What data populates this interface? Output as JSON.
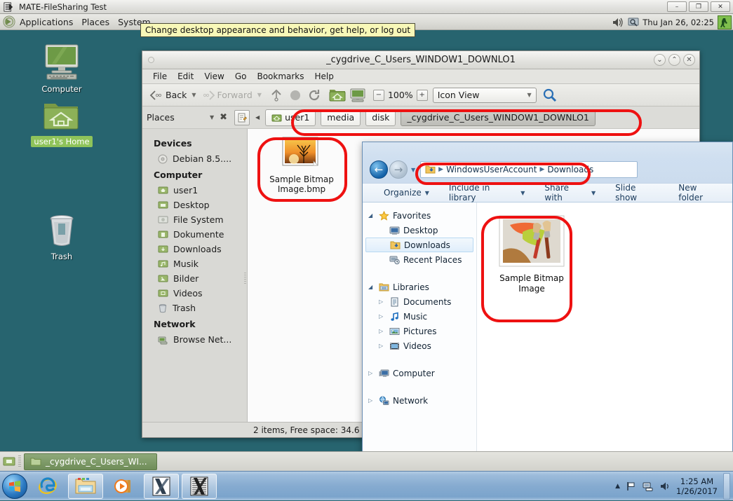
{
  "desktop": {
    "background_color": "#27646f",
    "icons": [
      {
        "label": "Computer",
        "icon": "computer-icon",
        "selected": false
      },
      {
        "label": "user1's Home",
        "icon": "home-folder-icon",
        "selected": true
      },
      {
        "label": "Trash",
        "icon": "trash-icon",
        "selected": false
      }
    ]
  },
  "mate_titlebar": {
    "title": "MATE-FileSharing Test",
    "icon": "window-menu-icon",
    "buttons": [
      {
        "name": "minimize",
        "glyph": "–"
      },
      {
        "name": "restore",
        "glyph": "❐"
      },
      {
        "name": "close",
        "glyph": "✕"
      }
    ]
  },
  "mate_panel": {
    "menus": [
      "Applications",
      "Places",
      "System"
    ],
    "clock": "Thu Jan 26, 02:25",
    "tray_icons": [
      "volume-icon",
      "screensaver-icon"
    ],
    "logout_icon": "logout-icon"
  },
  "tooltip": {
    "text": "Change desktop appearance and behavior, get help, or log out"
  },
  "caja": {
    "title": "_cygdrive_C_Users_WINDOW1_DOWNLO1",
    "window_buttons": [
      {
        "name": "minimize-icon",
        "glyph": "⌄"
      },
      {
        "name": "maximize-icon",
        "glyph": "⌃"
      },
      {
        "name": "close-icon",
        "glyph": "✕"
      }
    ],
    "menubar": [
      "File",
      "Edit",
      "View",
      "Go",
      "Bookmarks",
      "Help"
    ],
    "toolbar": {
      "back_label": "Back",
      "forward_label": "Forward",
      "up_icon": "up-arrow-icon",
      "stop_icon": "stop-icon",
      "reload_icon": "reload-icon",
      "home_icon": "home-icon",
      "computer_icon": "computer-icon",
      "zoom_out_glyph": "−",
      "zoom_value": "100%",
      "zoom_in_glyph": "+",
      "view_mode": "Icon View",
      "search_icon": "search-icon"
    },
    "location_bar": {
      "places_label": "Places",
      "places_dropdown_icon": "chevron-down-icon",
      "places_close_icon": "close-icon",
      "edit_location_icon": "edit-location-icon",
      "scroll_left_icon": "chevron-left-icon",
      "breadcrumbs": [
        {
          "label": "user1",
          "icon": "home-icon",
          "active": false
        },
        {
          "label": "media",
          "icon": "",
          "active": false
        },
        {
          "label": "disk",
          "icon": "",
          "active": false
        },
        {
          "label": "_cygdrive_C_Users_WINDOW1_DOWNLO1",
          "icon": "",
          "active": true
        }
      ]
    },
    "sidebar": {
      "groups": [
        {
          "heading": "Devices",
          "items": [
            {
              "label": "Debian 8.5....",
              "icon": "disc-icon"
            }
          ]
        },
        {
          "heading": "Computer",
          "items": [
            {
              "label": "user1",
              "icon": "home-folder-icon"
            },
            {
              "label": "Desktop",
              "icon": "desktop-folder-icon"
            },
            {
              "label": "File System",
              "icon": "filesystem-icon"
            },
            {
              "label": "Dokumente",
              "icon": "documents-folder-icon"
            },
            {
              "label": "Downloads",
              "icon": "downloads-folder-icon"
            },
            {
              "label": "Musik",
              "icon": "music-folder-icon"
            },
            {
              "label": "Bilder",
              "icon": "pictures-folder-icon"
            },
            {
              "label": "Videos",
              "icon": "videos-folder-icon"
            },
            {
              "label": "Trash",
              "icon": "trash-icon"
            }
          ]
        },
        {
          "heading": "Network",
          "items": [
            {
              "label": "Browse Net...",
              "icon": "network-icon"
            }
          ]
        }
      ]
    },
    "files": [
      {
        "name": "Sample Bitmap Image.bmp",
        "thumbnail": "sunset-tree-thumbnail"
      }
    ],
    "status": "2 items, Free space: 34.6"
  },
  "explorer": {
    "nav": {
      "back_icon": "back-arrow-icon",
      "forward_icon": "forward-arrow-icon",
      "recent_icon": "chevron-down-icon",
      "address_icon": "downloads-folder-icon",
      "breadcrumbs": [
        "WindowsUserAccount",
        "Downloads"
      ]
    },
    "commands": [
      {
        "label": "Organize",
        "has_dropdown": true
      },
      {
        "label": "Include in library",
        "has_dropdown": true
      },
      {
        "label": "Share with",
        "has_dropdown": true
      },
      {
        "label": "Slide show",
        "has_dropdown": false
      },
      {
        "label": "New folder",
        "has_dropdown": false
      }
    ],
    "tree": [
      {
        "label": "Favorites",
        "icon": "star-icon",
        "expander": "open",
        "indent": 0,
        "selected": false
      },
      {
        "label": "Desktop",
        "icon": "desktop-icon",
        "expander": "none",
        "indent": 1,
        "selected": false
      },
      {
        "label": "Downloads",
        "icon": "downloads-folder-icon",
        "expander": "none",
        "indent": 1,
        "selected": true
      },
      {
        "label": "Recent Places",
        "icon": "recent-places-icon",
        "expander": "none",
        "indent": 1,
        "selected": false
      },
      {
        "label": "Libraries",
        "icon": "libraries-icon",
        "expander": "open",
        "indent": 0,
        "selected": false
      },
      {
        "label": "Documents",
        "icon": "documents-icon",
        "expander": "closed",
        "indent": 1,
        "selected": false
      },
      {
        "label": "Music",
        "icon": "music-icon",
        "expander": "closed",
        "indent": 1,
        "selected": false
      },
      {
        "label": "Pictures",
        "icon": "pictures-icon",
        "expander": "closed",
        "indent": 1,
        "selected": false
      },
      {
        "label": "Videos",
        "icon": "videos-icon",
        "expander": "closed",
        "indent": 1,
        "selected": false
      },
      {
        "label": "Computer",
        "icon": "computer-icon",
        "expander": "closed",
        "indent": 0,
        "selected": false
      },
      {
        "label": "Network",
        "icon": "network-icon",
        "expander": "closed",
        "indent": 0,
        "selected": false
      }
    ],
    "files": [
      {
        "name": "Sample Bitmap Image",
        "thumbnail": "paintbrush-thumbnail"
      }
    ]
  },
  "mate_taskbar": {
    "show_desktop_icon": "show-desktop-icon",
    "tasks": [
      {
        "label": "_cygdrive_C_Users_WI...",
        "icon": "folder-icon"
      }
    ]
  },
  "windows_taskbar": {
    "start_icon": "windows-start-icon",
    "pinned": [
      {
        "name": "internet-explorer-icon"
      },
      {
        "name": "file-explorer-icon",
        "active": true
      },
      {
        "name": "media-player-icon"
      },
      {
        "name": "xming-icon"
      },
      {
        "name": "xlaunch-icon"
      }
    ],
    "tray": {
      "hidden_icons_glyph": "▲",
      "icons": [
        "action-center-flag-icon",
        "network-icon",
        "volume-icon"
      ],
      "time": "1:25 AM",
      "date": "1/26/2017"
    }
  },
  "annotations": {
    "color": "#ee1111",
    "regions": [
      "caja-breadcrumbs",
      "caja-file-item",
      "explorer-address-bar",
      "explorer-file-item"
    ]
  }
}
